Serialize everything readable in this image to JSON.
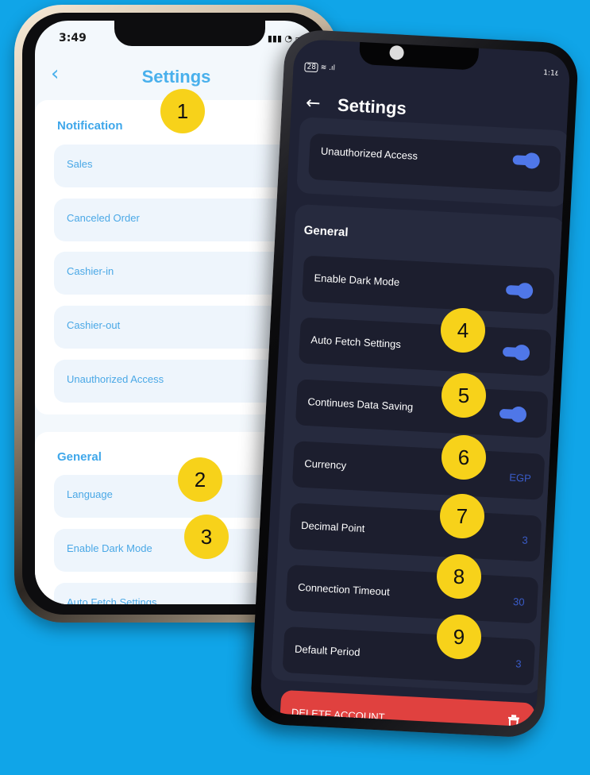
{
  "light": {
    "status_time": "3:49",
    "title": "Settings",
    "sections": {
      "notification": "Notification",
      "general": "General"
    },
    "items": [
      {
        "label": "Sales",
        "on": true
      },
      {
        "label": "Canceled Order",
        "on": true
      },
      {
        "label": "Cashier-in",
        "on": true
      },
      {
        "label": "Cashier-out",
        "on": true
      },
      {
        "label": "Unauthorized Access",
        "on": true
      }
    ],
    "general_items": [
      {
        "label": "Language"
      },
      {
        "label": "Enable Dark Mode",
        "on": false
      },
      {
        "label": "Auto Fetch Settings",
        "on": true
      }
    ]
  },
  "dark": {
    "title": "Settings",
    "status_time": "1:1٤",
    "status_battery": "28",
    "top_item": {
      "label": "Unauthorized Access",
      "on": true
    },
    "section_general": "General",
    "items": [
      {
        "label": "Enable Dark Mode",
        "on": true
      },
      {
        "label": "Auto Fetch Settings",
        "on": true
      },
      {
        "label": "Continues Data Saving",
        "on": true
      },
      {
        "label": "Currency",
        "value": "EGP"
      },
      {
        "label": "Decimal Point",
        "value": "3"
      },
      {
        "label": "Connection Timeout",
        "value": "30"
      },
      {
        "label": "Default Period",
        "value": "3"
      }
    ],
    "delete_label": "DELETE ACCOUNT"
  },
  "badges": [
    "1",
    "2",
    "3",
    "4",
    "5",
    "6",
    "7",
    "8",
    "9"
  ],
  "colors": {
    "background": "#10a5e8",
    "accent_light": "#3fa0ea",
    "accent_dark": "#4f77e8",
    "danger": "#e0413f",
    "badge": "#f7d21a"
  }
}
